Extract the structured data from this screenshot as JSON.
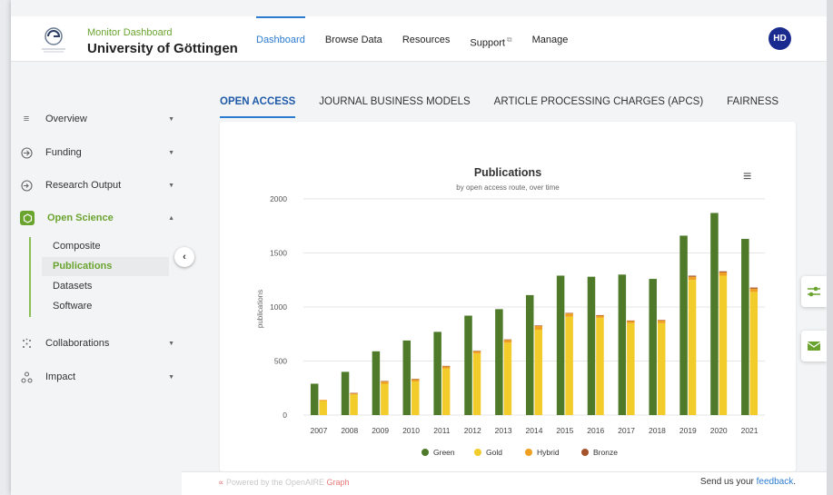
{
  "header": {
    "brand_subtitle": "Monitor Dashboard",
    "brand_title": "University of Göttingen",
    "nav": [
      {
        "label": "Dashboard",
        "active": true,
        "external": false
      },
      {
        "label": "Browse Data",
        "active": false,
        "external": false
      },
      {
        "label": "Resources",
        "active": false,
        "external": false
      },
      {
        "label": "Support",
        "active": false,
        "external": true
      },
      {
        "label": "Manage",
        "active": false,
        "external": false
      }
    ],
    "avatar_initials": "HD",
    "accent_color": "#2b7bd1",
    "brand_color": "#6aa42f"
  },
  "sidebar": {
    "items": [
      {
        "label": "Overview",
        "icon": "list-icon",
        "expanded": false
      },
      {
        "label": "Funding",
        "icon": "funding-icon",
        "expanded": false
      },
      {
        "label": "Research Output",
        "icon": "login-icon",
        "expanded": false
      },
      {
        "label": "Open Science",
        "icon": "open-science-icon",
        "expanded": true,
        "active": true
      },
      {
        "label": "Collaborations",
        "icon": "network-dots-icon",
        "expanded": false
      },
      {
        "label": "Impact",
        "icon": "impact-icon",
        "expanded": false
      }
    ],
    "subitems": [
      {
        "label": "Composite",
        "active": false
      },
      {
        "label": "Publications",
        "active": true
      },
      {
        "label": "Datasets",
        "active": false
      },
      {
        "label": "Software",
        "active": false
      }
    ]
  },
  "tabs": [
    {
      "label": "OPEN ACCESS",
      "active": true
    },
    {
      "label": "JOURNAL BUSINESS MODELS",
      "active": false
    },
    {
      "label": "ARTICLE PROCESSING CHARGES (APCS)",
      "active": false
    },
    {
      "label": "FAIRNESS",
      "active": false
    }
  ],
  "chart_data": {
    "type": "bar",
    "title": "Publications",
    "subtitle": "by open access route, over time",
    "ylabel": "publications",
    "xlabel": "",
    "ylim": [
      0,
      2000
    ],
    "yticks": [
      0,
      500,
      1000,
      1500,
      2000
    ],
    "grid": true,
    "legend_position": "bottom",
    "categories": [
      "2007",
      "2008",
      "2009",
      "2010",
      "2011",
      "2012",
      "2013",
      "2014",
      "2015",
      "2016",
      "2017",
      "2018",
      "2019",
      "2020",
      "2021"
    ],
    "series": [
      {
        "name": "Green",
        "color": "#4e7a2a",
        "values": [
          290,
          400,
          590,
          690,
          770,
          920,
          980,
          1110,
          1290,
          1280,
          1300,
          1260,
          1660,
          1870,
          1630
        ]
      },
      {
        "name": "Gold",
        "color": "#f2cc2a",
        "values": [
          130,
          190,
          290,
          310,
          430,
          570,
          670,
          790,
          910,
          900,
          850,
          850,
          1250,
          1290,
          1140
        ]
      },
      {
        "name": "Hybrid",
        "color": "#f0a020",
        "values": [
          10,
          10,
          20,
          20,
          20,
          20,
          25,
          35,
          30,
          20,
          20,
          25,
          30,
          30,
          30
        ]
      },
      {
        "name": "Bronze",
        "color": "#a5532a",
        "values": [
          0,
          5,
          5,
          5,
          5,
          5,
          5,
          5,
          5,
          5,
          5,
          5,
          10,
          10,
          10
        ]
      }
    ]
  },
  "footer": {
    "powered_prefix": "Powered by the ",
    "powered_brand": "OpenAIRE",
    "powered_graph": "Graph",
    "feedback_prefix": "Send us your ",
    "feedback_link": "feedback",
    "feedback_suffix": "."
  }
}
